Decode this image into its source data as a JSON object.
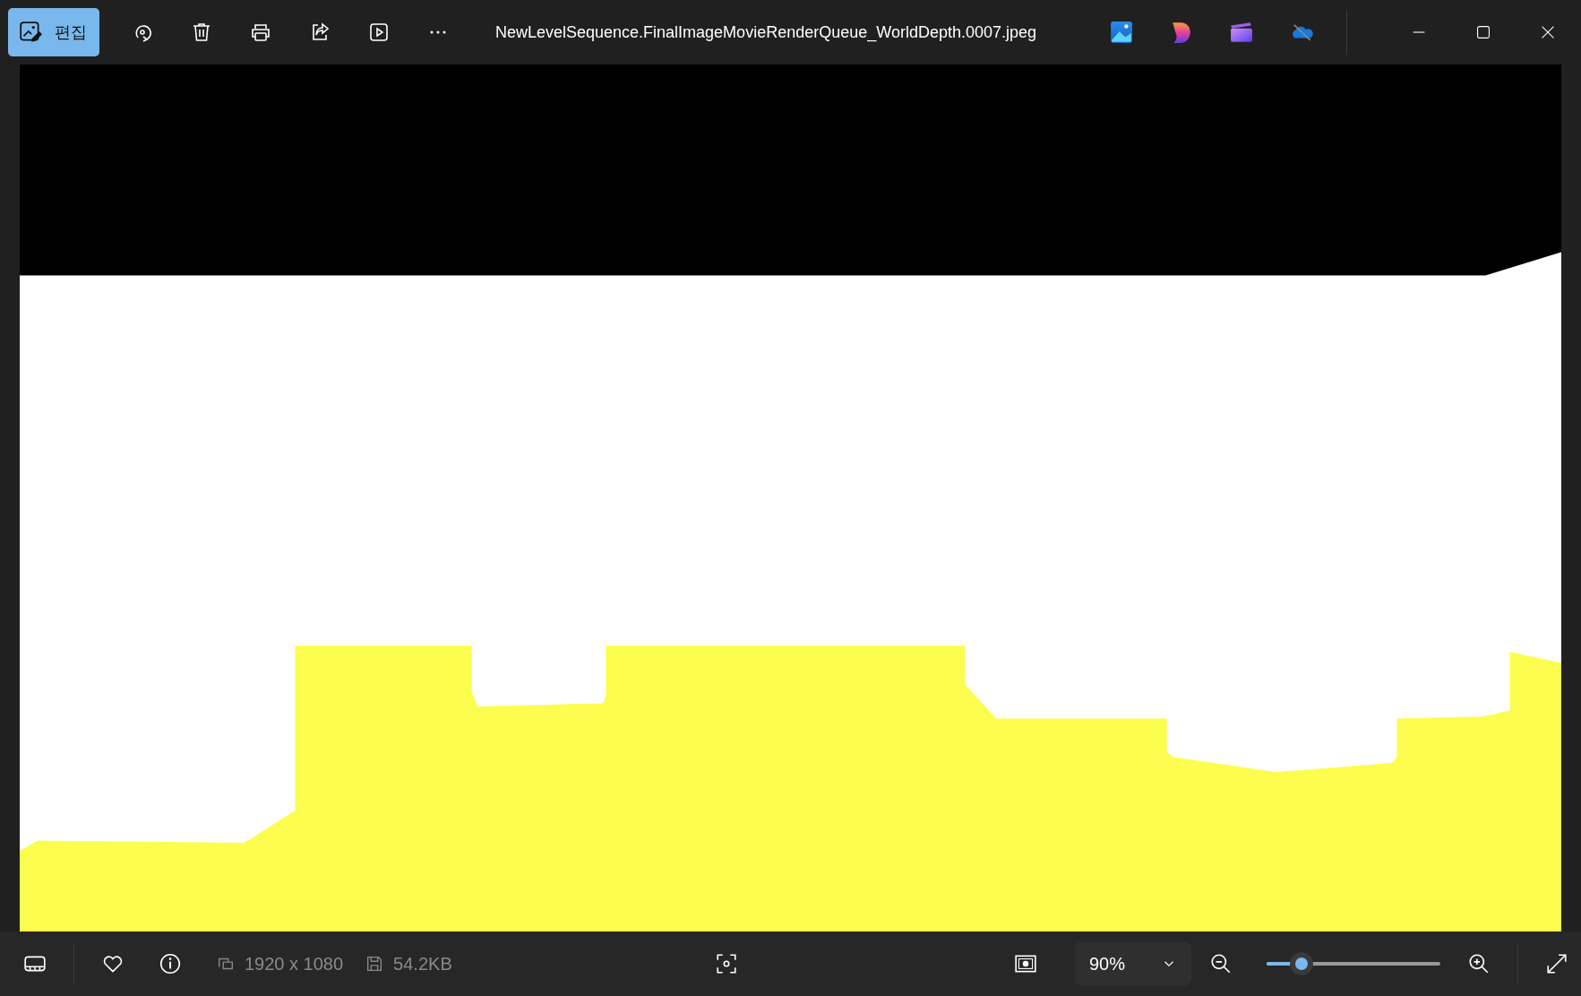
{
  "window": {
    "title": "NewLevelSequence.FinalImageMovieRenderQueue_WorldDepth.0007.jpeg"
  },
  "toolbar": {
    "edit_button": "편집"
  },
  "status_bar": {
    "dimensions": "1920 x 1080",
    "file_size": "54.2KB",
    "zoom": "90%",
    "zoom_slider": {
      "level": 0.16
    }
  }
}
